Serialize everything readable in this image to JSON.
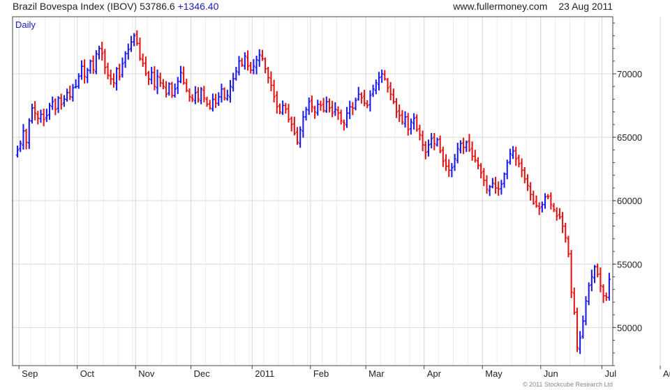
{
  "header": {
    "title": "Brazil Bovespa Index (IBOV)",
    "last": "53786.6",
    "change": "+1346.40",
    "site": "www.fullermoney.com",
    "date": "23 Aug 2011"
  },
  "copyright": "© 2011 Stockcube Research Ltd",
  "colors": {
    "up": "#1616e6",
    "down": "#e01010",
    "grid": "#d8d8d8",
    "frame": "#444444",
    "interval": "#1a1ab8"
  },
  "chart_data": {
    "type": "ohlc",
    "interval_label": "Daily",
    "ylim": [
      47000,
      74500
    ],
    "y_ticks": [
      50000,
      55000,
      60000,
      65000,
      70000
    ],
    "y_tick_labels": [
      "50000",
      "55000",
      "60000",
      "65000",
      "70000"
    ],
    "grid": true,
    "months": [
      {
        "label": "Sep",
        "start": 1
      },
      {
        "label": "Oct",
        "start": 21
      },
      {
        "label": "Nov",
        "start": 41
      },
      {
        "label": "Dec",
        "start": 60
      },
      {
        "label": "2011",
        "start": 81
      },
      {
        "label": "Feb",
        "start": 101
      },
      {
        "label": "Mar",
        "start": 120
      },
      {
        "label": "Apr",
        "start": 140
      },
      {
        "label": "May",
        "start": 160
      },
      {
        "label": "Jun",
        "start": 180
      },
      {
        "label": "Jul",
        "start": 201
      },
      {
        "label": "Aug",
        "start": 221
      }
    ],
    "closes": [
      64000,
      64500,
      65500,
      64600,
      66300,
      67300,
      66900,
      66500,
      66800,
      66400,
      66700,
      67500,
      67800,
      67200,
      68100,
      67600,
      68000,
      68500,
      68200,
      68900,
      69000,
      69800,
      70600,
      69800,
      70300,
      71000,
      70300,
      71600,
      72000,
      71600,
      70500,
      69900,
      69600,
      69300,
      70400,
      69800,
      70800,
      71600,
      71900,
      72500,
      73000,
      72400,
      71200,
      70800,
      70000,
      69600,
      70100,
      69000,
      69800,
      69300,
      69000,
      68400,
      69200,
      68300,
      68800,
      69400,
      70100,
      69300,
      68700,
      68200,
      68000,
      68500,
      68000,
      68800,
      68100,
      67600,
      67300,
      68000,
      67700,
      68200,
      68800,
      68100,
      68300,
      69000,
      69600,
      70200,
      71000,
      70700,
      71400,
      70600,
      70300,
      70600,
      71100,
      71500,
      71200,
      70400,
      69700,
      69100,
      68200,
      67400,
      67000,
      67500,
      67200,
      66400,
      66000,
      65300,
      64600,
      65600,
      66600,
      67200,
      67800,
      67400,
      67000,
      67600,
      67500,
      67100,
      67800,
      67300,
      66900,
      67200,
      66900,
      66300,
      66100,
      66900,
      67400,
      67300,
      67900,
      68400,
      68100,
      67700,
      67500,
      68300,
      68800,
      69300,
      69700,
      70000,
      69600,
      68900,
      68400,
      67800,
      67000,
      66700,
      66200,
      66600,
      65600,
      66200,
      66500,
      65600,
      65200,
      64400,
      63800,
      64400,
      64900,
      64500,
      64800,
      63900,
      63100,
      62700,
      62400,
      62600,
      63300,
      64100,
      64500,
      64200,
      64600,
      64000,
      63500,
      63200,
      62800,
      62200,
      61600,
      60900,
      61100,
      61400,
      61000,
      60900,
      61300,
      62100,
      63000,
      63700,
      63900,
      63300,
      62900,
      62400,
      61700,
      61200,
      60500,
      59800,
      59600,
      59400,
      59700,
      60300,
      60300,
      59700,
      59300,
      58800,
      58700,
      58000,
      57100,
      55800,
      52800,
      51200,
      48400,
      49200,
      50500,
      52100,
      53300,
      54000,
      54800,
      54200,
      53300,
      52500,
      52400,
      53800
    ]
  }
}
